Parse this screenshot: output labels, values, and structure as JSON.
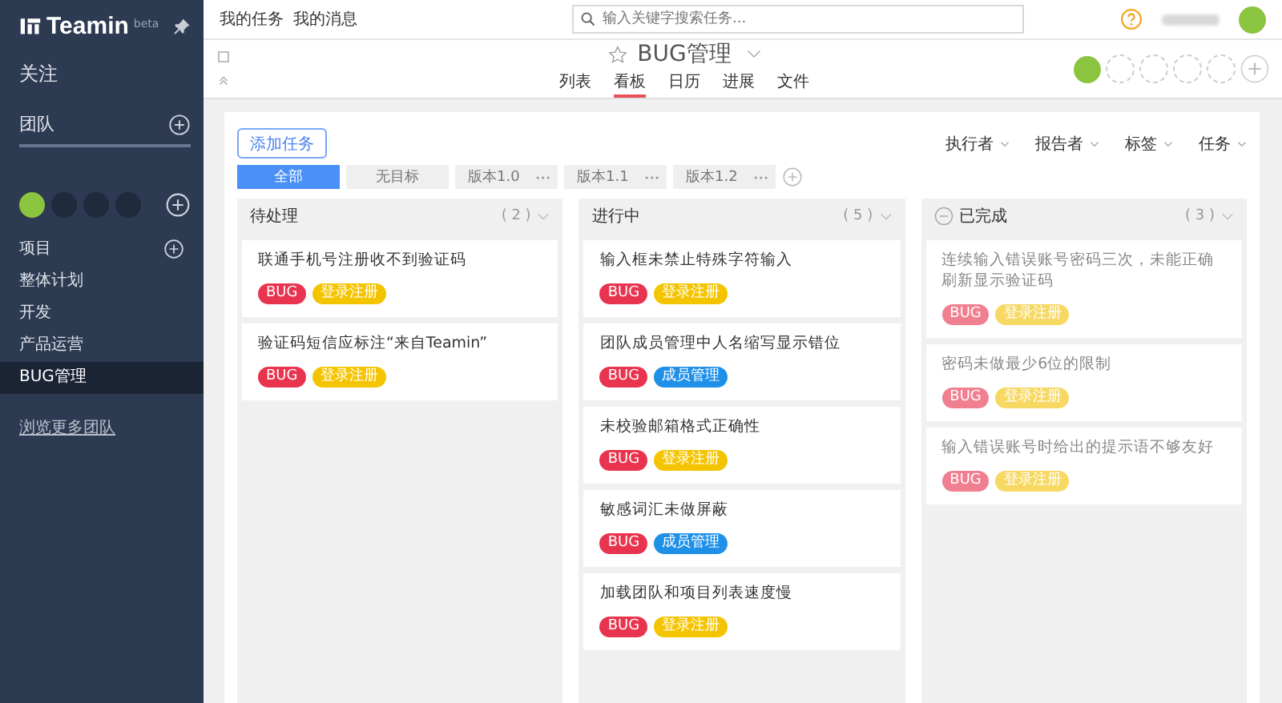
{
  "sidebar": {
    "logo": "Teamin",
    "badge": "beta",
    "follow": "关注",
    "team_heading": "团队",
    "projects_heading": "项目",
    "projects": [
      {
        "label": "整体计划",
        "selected": false
      },
      {
        "label": "开发",
        "selected": false
      },
      {
        "label": "产品运营",
        "selected": false
      },
      {
        "label": "BUG管理",
        "selected": true
      }
    ],
    "browse_link": "浏览更多团队"
  },
  "top_nav": [
    "我的任务",
    "我的消息"
  ],
  "search": {
    "placeholder": "输入关键字搜索任务..."
  },
  "project": {
    "title": "BUG管理",
    "views": [
      {
        "label": "列表",
        "selected": false
      },
      {
        "label": "看板",
        "selected": true
      },
      {
        "label": "日历",
        "selected": false
      },
      {
        "label": "进展",
        "selected": false
      },
      {
        "label": "文件",
        "selected": false
      }
    ]
  },
  "add_task": "添加任务",
  "filters": [
    {
      "label": "全部",
      "selected": true,
      "kind": "plain"
    },
    {
      "label": "无目标",
      "selected": false,
      "kind": "plain"
    },
    {
      "label": "版本1.0",
      "selected": false,
      "kind": "version"
    },
    {
      "label": "版本1.1",
      "selected": false,
      "kind": "version"
    },
    {
      "label": "版本1.2",
      "selected": false,
      "kind": "version"
    }
  ],
  "dropdowns": [
    "执行者",
    "报告者",
    "标签",
    "任务"
  ],
  "columns": [
    {
      "title": "待处理",
      "count": "( 2 )",
      "completed": false,
      "cards": [
        {
          "title": "联通手机号注册收不到验证码",
          "tags": [
            {
              "label": "BUG",
              "color": "#e8344e"
            },
            {
              "label": "登录注册",
              "color": "#f5c400"
            }
          ]
        },
        {
          "title": "验证码短信应标注“来自Teamin”",
          "tags": [
            {
              "label": "BUG",
              "color": "#e8344e"
            },
            {
              "label": "登录注册",
              "color": "#f5c400"
            }
          ]
        }
      ]
    },
    {
      "title": "进行中",
      "count": "( 5 )",
      "completed": false,
      "cards": [
        {
          "title": "输入框未禁止特殊字符输入",
          "tags": [
            {
              "label": "BUG",
              "color": "#e8344e"
            },
            {
              "label": "登录注册",
              "color": "#f5c400"
            }
          ]
        },
        {
          "title": "团队成员管理中人名缩写显示错位",
          "tags": [
            {
              "label": "BUG",
              "color": "#e8344e"
            },
            {
              "label": "成员管理",
              "color": "#1e90e8"
            }
          ]
        },
        {
          "title": "未校验邮箱格式正确性",
          "tags": [
            {
              "label": "BUG",
              "color": "#e8344e"
            },
            {
              "label": "登录注册",
              "color": "#f5c400"
            }
          ]
        },
        {
          "title": "敏感词汇未做屏蔽",
          "tags": [
            {
              "label": "BUG",
              "color": "#e8344e"
            },
            {
              "label": "成员管理",
              "color": "#1e90e8"
            }
          ]
        },
        {
          "title": "加载团队和项目列表速度慢",
          "tags": [
            {
              "label": "BUG",
              "color": "#e8344e"
            },
            {
              "label": "登录注册",
              "color": "#f5c400"
            }
          ]
        }
      ]
    },
    {
      "title": "已完成",
      "count": "( 3 )",
      "completed": true,
      "cards": [
        {
          "title": "连续输入错误账号密码三次，未能正确刷新显示验证码",
          "tags": [
            {
              "label": "BUG",
              "color": "#f07f8f"
            },
            {
              "label": "登录注册",
              "color": "#f6d862"
            }
          ]
        },
        {
          "title": "密码未做最少6位的限制",
          "tags": [
            {
              "label": "BUG",
              "color": "#f07f8f"
            },
            {
              "label": "登录注册",
              "color": "#f6d862"
            }
          ]
        },
        {
          "title": "输入错误账号时给出的提示语不够友好",
          "tags": [
            {
              "label": "BUG",
              "color": "#f07f8f"
            },
            {
              "label": "登录注册",
              "color": "#f6d862"
            }
          ]
        }
      ]
    }
  ]
}
